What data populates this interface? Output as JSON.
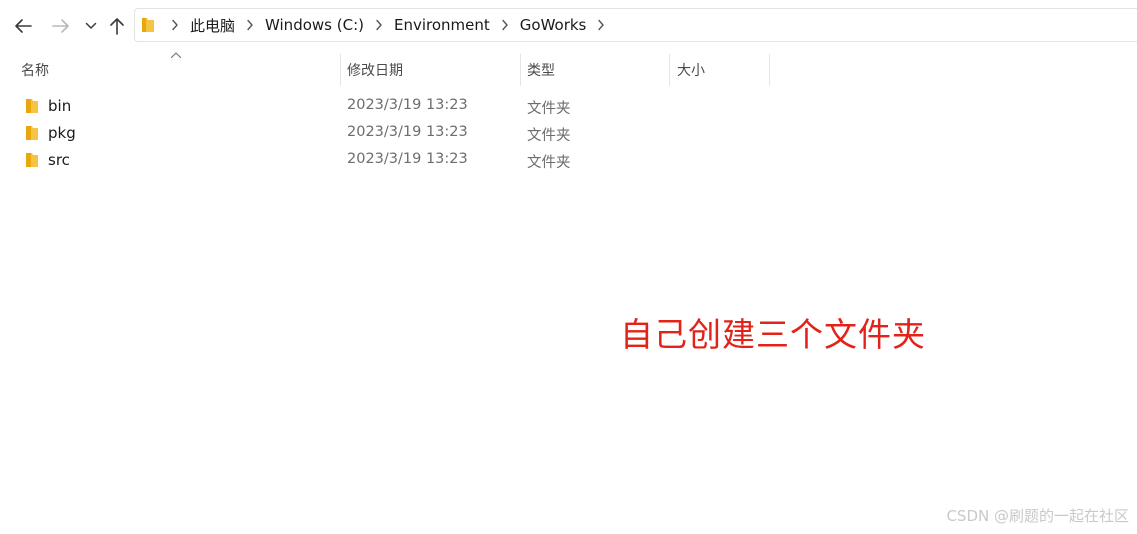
{
  "navigation": {
    "back_icon": "arrow-left-icon",
    "forward_icon": "arrow-right-icon",
    "recent_icon": "chevron-down-icon",
    "up_icon": "arrow-up-icon"
  },
  "breadcrumbs": [
    "此电脑",
    "Windows (C:)",
    "Environment",
    "GoWorks"
  ],
  "columns": {
    "name": "名称",
    "date_modified": "修改日期",
    "type": "类型",
    "size": "大小"
  },
  "files": [
    {
      "name": "bin",
      "date_modified": "2023/3/19 13:23",
      "type": "文件夹",
      "icon": "folder-icon"
    },
    {
      "name": "pkg",
      "date_modified": "2023/3/19 13:23",
      "type": "文件夹",
      "icon": "folder-icon"
    },
    {
      "name": "src",
      "date_modified": "2023/3/19 13:23",
      "type": "文件夹",
      "icon": "folder-icon"
    }
  ],
  "annotation": "自己创建三个文件夹",
  "watermark": "CSDN @刷题的一起在社区",
  "colors": {
    "annotation": "#e2231a",
    "folder": "#f5c443",
    "folder_dark": "#e8a80c"
  }
}
